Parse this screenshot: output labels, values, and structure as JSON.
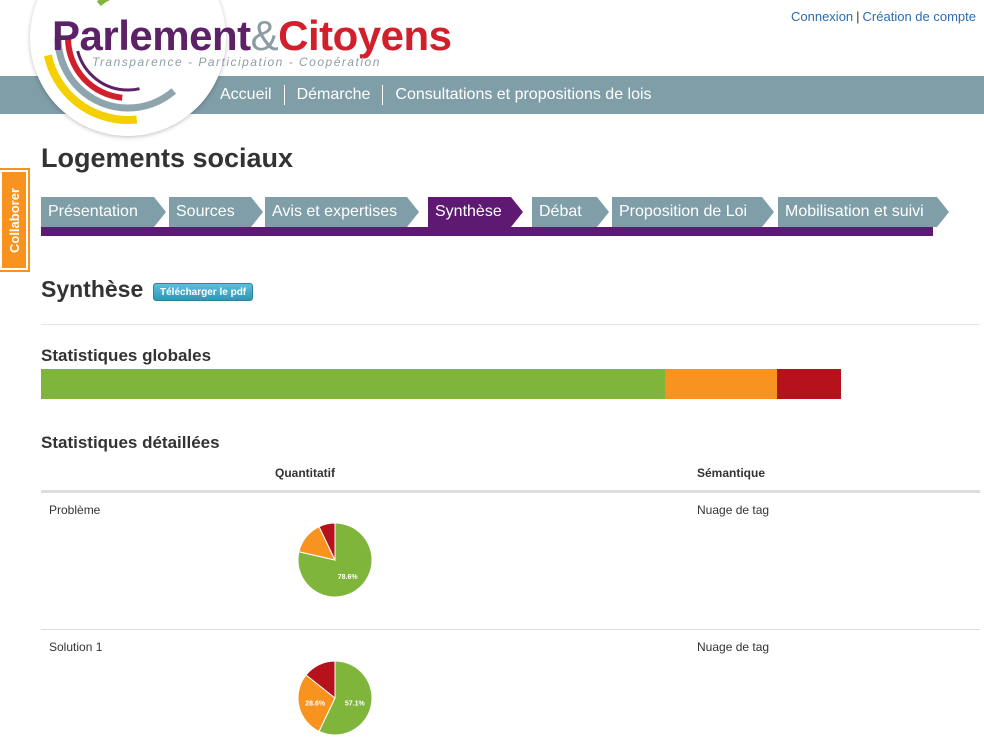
{
  "header": {
    "logo": {
      "part1": "Parlement",
      "ampersand": "&",
      "part2": "Citoyens",
      "tagline": "Transparence - Participation - Coopération"
    },
    "auth": {
      "login": "Connexion",
      "separator": "|",
      "register": "Création de compte"
    },
    "nav": [
      "Accueil",
      "Démarche",
      "Consultations et propositions de lois"
    ]
  },
  "sidebar": {
    "collaborate_label": "Collaborer"
  },
  "page": {
    "title": "Logements sociaux",
    "steps": [
      {
        "label": "Présentation",
        "active": false
      },
      {
        "label": "Sources",
        "active": false
      },
      {
        "label": "Avis et expertises",
        "active": false
      },
      {
        "label": "Synthèse",
        "active": true
      },
      {
        "label": "Débat",
        "active": false
      },
      {
        "label": "Proposition de Loi",
        "active": false
      },
      {
        "label": "Mobilisation et suivi",
        "active": false
      }
    ],
    "section_title": "Synthèse",
    "pdf_button": "Télécharger le pdf",
    "global_stats": {
      "title": "Statistiques globales",
      "segments": [
        {
          "color": "#80b53c",
          "fraction": 0.78
        },
        {
          "color": "#f7931e",
          "fraction": 0.14
        },
        {
          "color": "#b5121b",
          "fraction": 0.08
        }
      ]
    },
    "detail_stats": {
      "title": "Statistiques détaillées",
      "col_quant": "Quantitatif",
      "col_sem": "Sémantique",
      "rows": [
        {
          "label": "Problème",
          "semantic": "Nuage de tag",
          "pie": [
            {
              "label": "78.6%",
              "value": 78.6,
              "color": "#80b53c"
            },
            {
              "label": "",
              "value": 14.3,
              "color": "#f7931e"
            },
            {
              "label": "",
              "value": 7.1,
              "color": "#b5121b"
            }
          ]
        },
        {
          "label": "Solution 1",
          "semantic": "Nuage de tag",
          "pie": [
            {
              "label": "57.1%",
              "value": 57.1,
              "color": "#80b53c"
            },
            {
              "label": "28.6%",
              "value": 28.6,
              "color": "#f7931e"
            },
            {
              "label": "",
              "value": 14.3,
              "color": "#b5121b"
            }
          ]
        }
      ]
    }
  }
}
